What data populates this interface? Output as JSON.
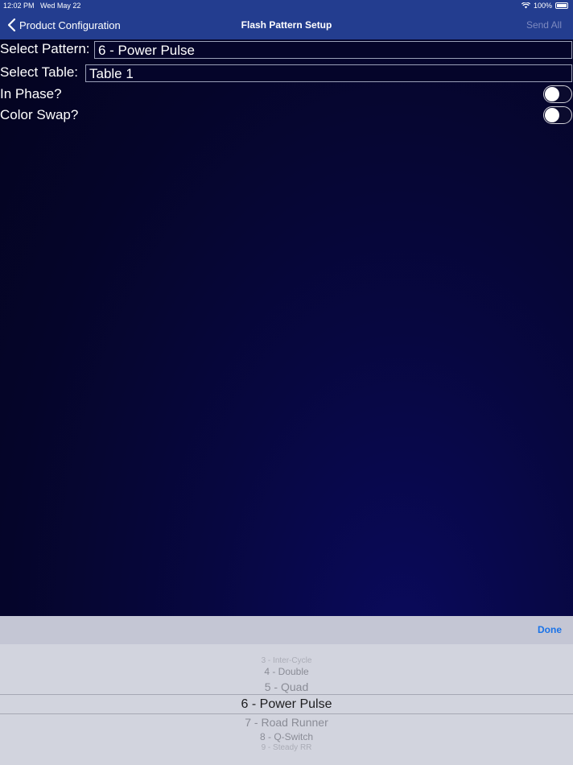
{
  "status_bar": {
    "time": "12:02 PM",
    "date": "Wed May 22",
    "battery": "100%"
  },
  "nav": {
    "back_label": "Product Configuration",
    "title": "Flash Pattern Setup",
    "send_all": "Send All"
  },
  "form": {
    "pattern_label": "Select Pattern:",
    "pattern_value": "6 - Power Pulse",
    "table_label": "Select Table:",
    "table_value": "Table 1",
    "in_phase_label": "In Phase?",
    "in_phase_on": false,
    "color_swap_label": "Color Swap?",
    "color_swap_on": false
  },
  "picker": {
    "done_label": "Done",
    "options": [
      "3 - Inter-Cycle",
      "4 - Double",
      "5 - Quad",
      "6 - Power Pulse",
      "7 - Road Runner",
      "8 - Q-Switch",
      "9 - Steady RR"
    ],
    "selected": "6 - Power Pulse"
  }
}
